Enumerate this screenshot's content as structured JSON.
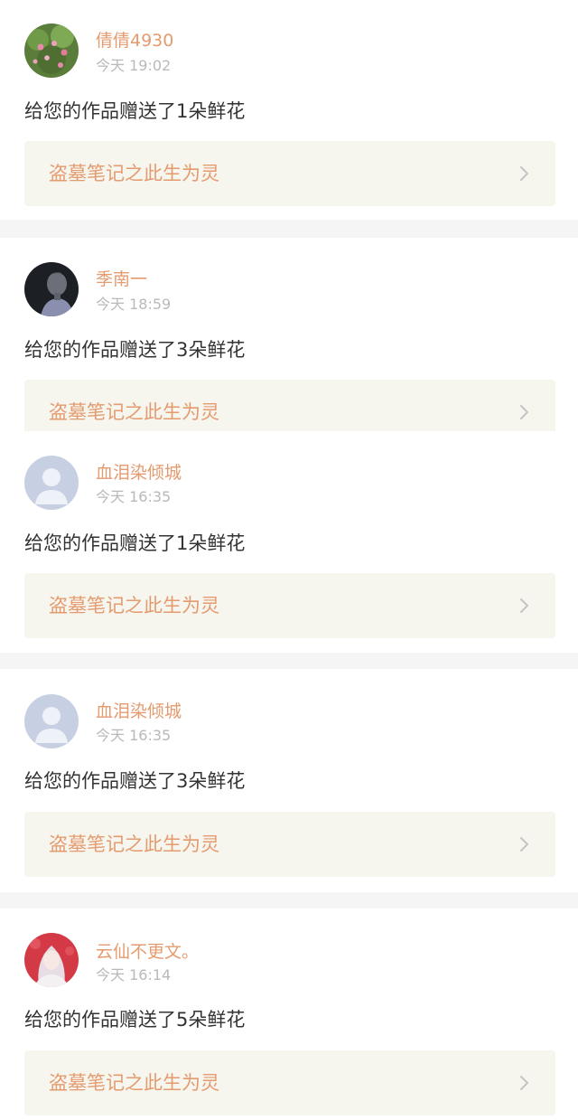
{
  "notifications": [
    {
      "user": "倩倩4930",
      "time": "今天 19:02",
      "message": "给您的作品赠送了1朵鲜花",
      "work_title": "盗墓笔记之此生为灵",
      "avatar": "flower-photo-avatar"
    },
    {
      "user": "季南一",
      "time": "今天 18:59",
      "message": "给您的作品赠送了3朵鲜花",
      "work_title": "盗墓笔记之此生为灵",
      "avatar": "dark-portrait-avatar"
    },
    {
      "user": "血泪染倾城",
      "time": "今天 16:35",
      "message": "给您的作品赠送了1朵鲜花",
      "work_title": "盗墓笔记之此生为灵",
      "avatar": "default-user-avatar"
    },
    {
      "user": "血泪染倾城",
      "time": "今天 16:35",
      "message": "给您的作品赠送了3朵鲜花",
      "work_title": "盗墓笔记之此生为灵",
      "avatar": "default-user-avatar"
    },
    {
      "user": "云仙不更文。",
      "time": "今天 16:14",
      "message": "给您的作品赠送了5朵鲜花",
      "work_title": "盗墓笔记之此生为灵",
      "avatar": "anime-girl-avatar"
    }
  ],
  "colors": {
    "accent": "#e49b6f",
    "text": "#333333",
    "muted": "#b9b9b9",
    "work_bg": "#f6f5ee",
    "separator": "#f5f5f5"
  },
  "icons": {
    "row_arrow": "chevron-right-icon"
  }
}
